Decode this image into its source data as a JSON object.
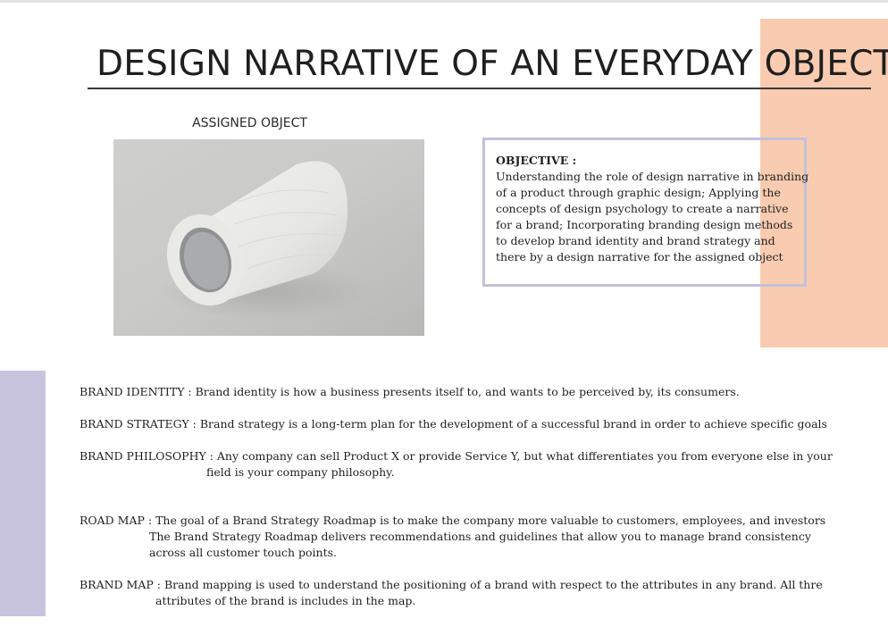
{
  "title": "DESIGN NARRATIVE OF AN EVERYDAY OBJECT",
  "assigned_object_label": "ASSIGNED OBJECT",
  "objective": {
    "heading": "OBJECTIVE :",
    "lines": [
      "Understanding the role of design narrative in branding",
      "of a product through graphic design; Applying the",
      "concepts of design psychology to create a narrative",
      "for a brand; Incorporating branding design methods",
      "to develop brand identity and brand strategy and",
      "there by a design narrative for the assigned object"
    ]
  },
  "entries": {
    "brand_identity": "BRAND IDENTITY :  Brand identity is how a business presents itself to, and wants to be perceived by, its consumers.",
    "brand_strategy": "BRAND STRATEGY : Brand strategy is a long-term plan for the development of a successful brand in order to achieve specific goals",
    "brand_philosophy": {
      "line1": "BRAND PHILOSOPHY : Any company can sell Product X or provide Service Y, but what differentiates you from everyone else in your",
      "line2": "field is your company philosophy."
    },
    "road_map": {
      "line1": "ROAD MAP : The goal of a Brand Strategy Roadmap is to make the company more valuable to customers, employees, and investors",
      "line2": "The Brand Strategy Roadmap delivers recommendations and guidelines that allow you to manage brand consistency",
      "line3": "across all customer touch points."
    },
    "brand_map": {
      "line1": "BRAND MAP : Brand mapping is used to understand the positioning of a brand with respect to the attributes in any brand. All thre",
      "line2": "attributes of the brand is includes in the map."
    }
  },
  "colors": {
    "peach_accent": "#f9cbb0",
    "lavender_accent": "#c9c4dd",
    "objective_border": "#c3c0db"
  }
}
